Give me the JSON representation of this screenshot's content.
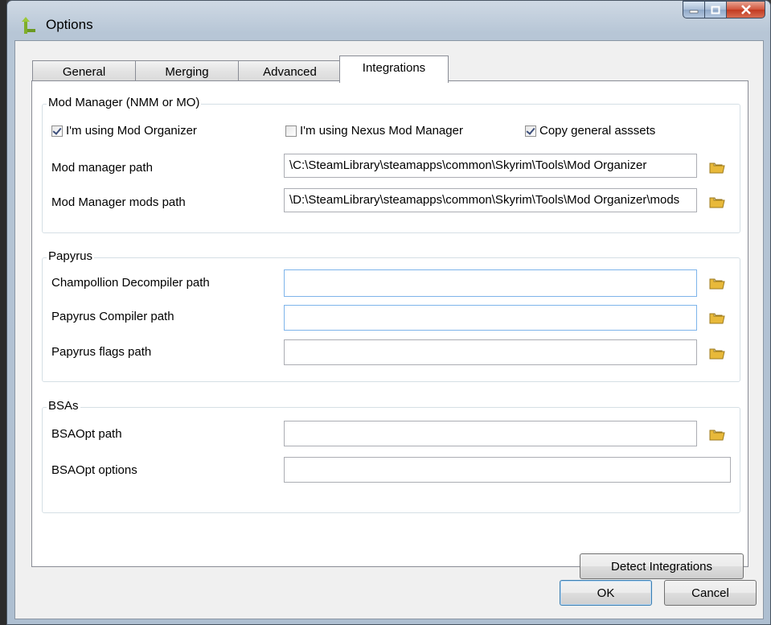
{
  "window": {
    "title": "Options",
    "app_icon": "app-icon",
    "caption_buttons": [
      "minimize-icon",
      "maximize-icon",
      "close-icon"
    ]
  },
  "tabs": [
    {
      "label": "General",
      "active": false
    },
    {
      "label": "Merging",
      "active": false
    },
    {
      "label": "Advanced",
      "active": false
    },
    {
      "label": "Integrations",
      "active": true
    }
  ],
  "mod_manager": {
    "legend": "Mod Manager (NMM or MO)",
    "using_mo": {
      "label": "I'm using Mod Organizer",
      "checked": true
    },
    "using_nmm": {
      "label": "I'm using Nexus Mod Manager",
      "checked": false
    },
    "copy_assets": {
      "label": "Copy general asssets",
      "checked": true
    },
    "path_label": "Mod manager path",
    "path_value": "C:\\SteamLibrary\\steamapps\\common\\Skyrim\\Tools\\Mod Organizer\\",
    "mods_path_label": "Mod Manager mods path",
    "mods_path_value": "D:\\SteamLibrary\\steamapps\\common\\Skyrim\\Tools\\Mod Organizer\\mods\\"
  },
  "papyrus": {
    "legend": "Papyrus",
    "decompiler_label": "Champollion Decompiler path",
    "decompiler_value": "",
    "compiler_label": "Papyrus Compiler path",
    "compiler_value": "",
    "flags_label": "Papyrus flags path",
    "flags_value": ""
  },
  "bsas": {
    "legend": "BSAs",
    "bsaopt_path_label": "BSAOpt path",
    "bsaopt_path_value": "",
    "bsaopt_options_label": "BSAOpt options",
    "bsaopt_options_value": ""
  },
  "buttons": {
    "detect": "Detect Integrations",
    "ok": "OK",
    "cancel": "Cancel"
  },
  "icons": {
    "browse": "folder-icon"
  },
  "colors": {
    "folder": "#e8b93a",
    "accent": "#3c7fb1"
  }
}
